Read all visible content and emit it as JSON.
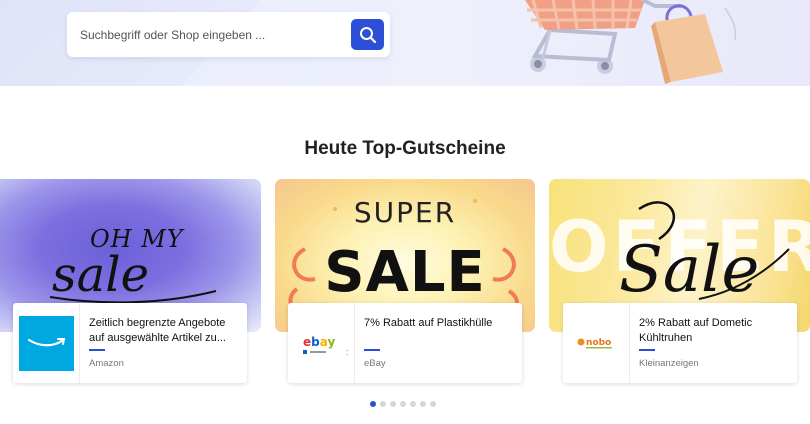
{
  "search": {
    "placeholder": "Suchbegriff oder Shop eingeben ..."
  },
  "section": {
    "title": "Heute Top-Gutscheine"
  },
  "coupons": [
    {
      "banner_text": "OH MY sale",
      "title": "Zeitlich begrenzte Angebote auf ausgewählte Artikel zu...",
      "shop": "Amazon",
      "logo_icon": "amazon-logo-icon"
    },
    {
      "banner_text": "SUPER SALE",
      "title": "7% Rabatt auf Plastikhülle",
      "shop": "eBay",
      "logo_icon": "ebay-logo-icon"
    },
    {
      "banner_text": "OFFER Sale",
      "title": "2% Rabatt auf Dometic Kühltruhen",
      "shop": "Kleinanzeigen",
      "logo_icon": "nobo-logo-icon"
    }
  ],
  "pagination": {
    "count": 7,
    "active_index": 0
  },
  "colors": {
    "accent": "#2d4fd8",
    "hero_bg": "#e9ecfb",
    "amazon_blue": "#00a8e1"
  }
}
